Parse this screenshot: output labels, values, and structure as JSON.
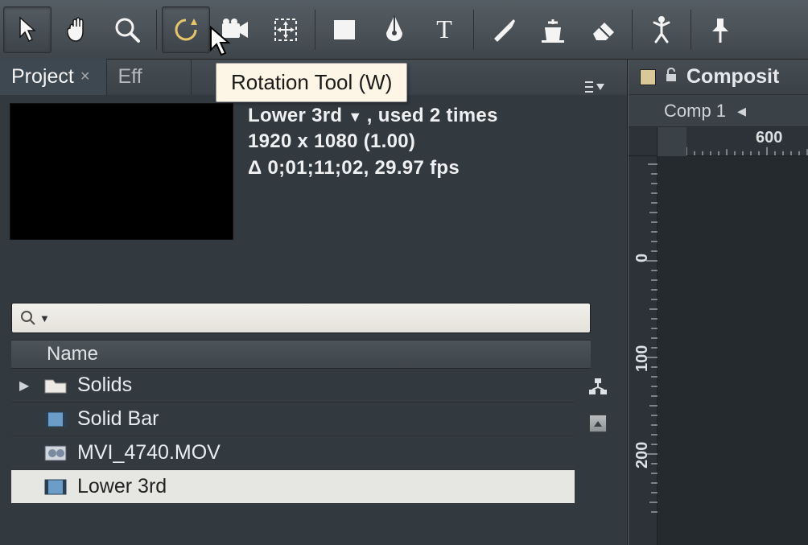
{
  "tooltip": "Rotation Tool (W)",
  "tabs": {
    "project": "Project",
    "effects_partial": "Eff"
  },
  "comp_info": {
    "name": "Lower 3rd",
    "used_suffix": ", used 2 times",
    "dims": "1920 x 1080 (1.00)",
    "timecode": "Δ 0;01;11;02, 29.97 fps"
  },
  "project_panel": {
    "name_header": "Name",
    "items": [
      {
        "label": "Solids",
        "type": "folder",
        "expandable": true
      },
      {
        "label": "Solid Bar",
        "type": "comp"
      },
      {
        "label": "MVI_4740.MOV",
        "type": "footage"
      },
      {
        "label": "Lower 3rd",
        "type": "comp",
        "selected": true
      }
    ]
  },
  "right": {
    "title": "Composit",
    "comp_tab": "Comp 1",
    "ruler_h_label": "600",
    "ruler_v_labels": [
      "0",
      "100",
      "200"
    ]
  },
  "toolbar_icons": [
    "selection-icon",
    "hand-icon",
    "zoom-icon",
    "rotation-icon",
    "camera-icon",
    "pan-behind-icon",
    "rectangle-icon",
    "pen-icon",
    "type-icon",
    "brush-icon",
    "clone-icon",
    "eraser-icon",
    "puppet-icon",
    "pin-icon"
  ]
}
